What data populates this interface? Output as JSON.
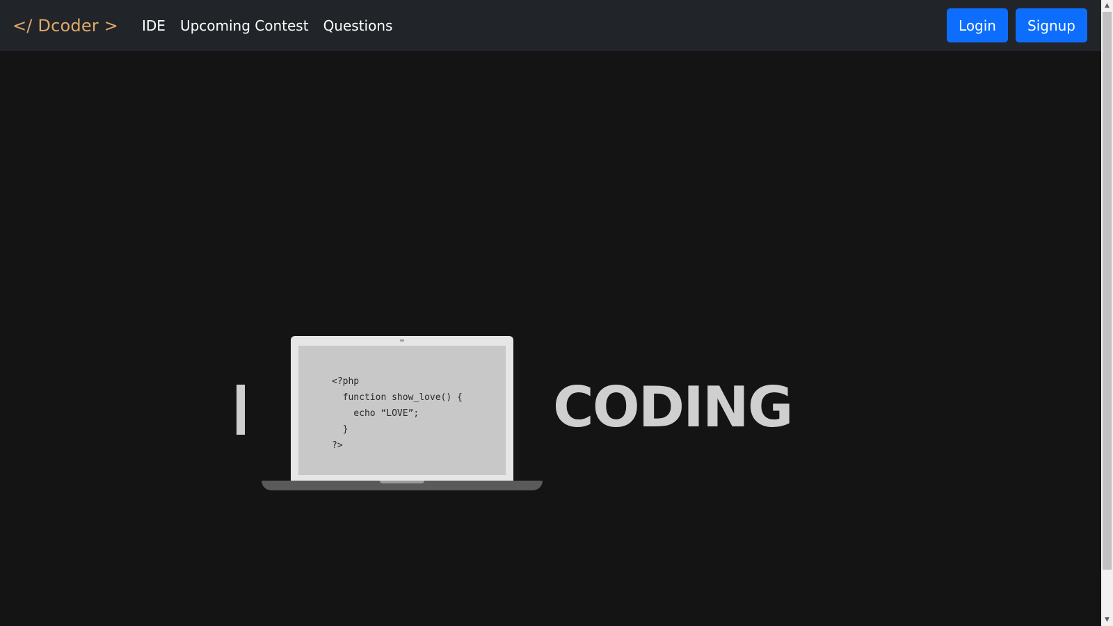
{
  "navbar": {
    "brand": "</ Dcoder >",
    "links": [
      "IDE",
      "Upcoming Contest",
      "Questions"
    ],
    "buttons": {
      "login": "Login",
      "signup": "Signup"
    },
    "colors": {
      "background": "#212529",
      "brand": "#e0a86a",
      "button": "#0d6efd"
    }
  },
  "hero": {
    "left_word": "I",
    "right_word": "CODING",
    "code_lines": [
      "<?php",
      "  function show_love() {",
      "    echo “LOVE”;",
      "  }",
      "?>"
    ],
    "icons": [
      "laptop-icon"
    ]
  },
  "scrollbar": {
    "up_icon": "▲",
    "down_icon": "▼"
  }
}
